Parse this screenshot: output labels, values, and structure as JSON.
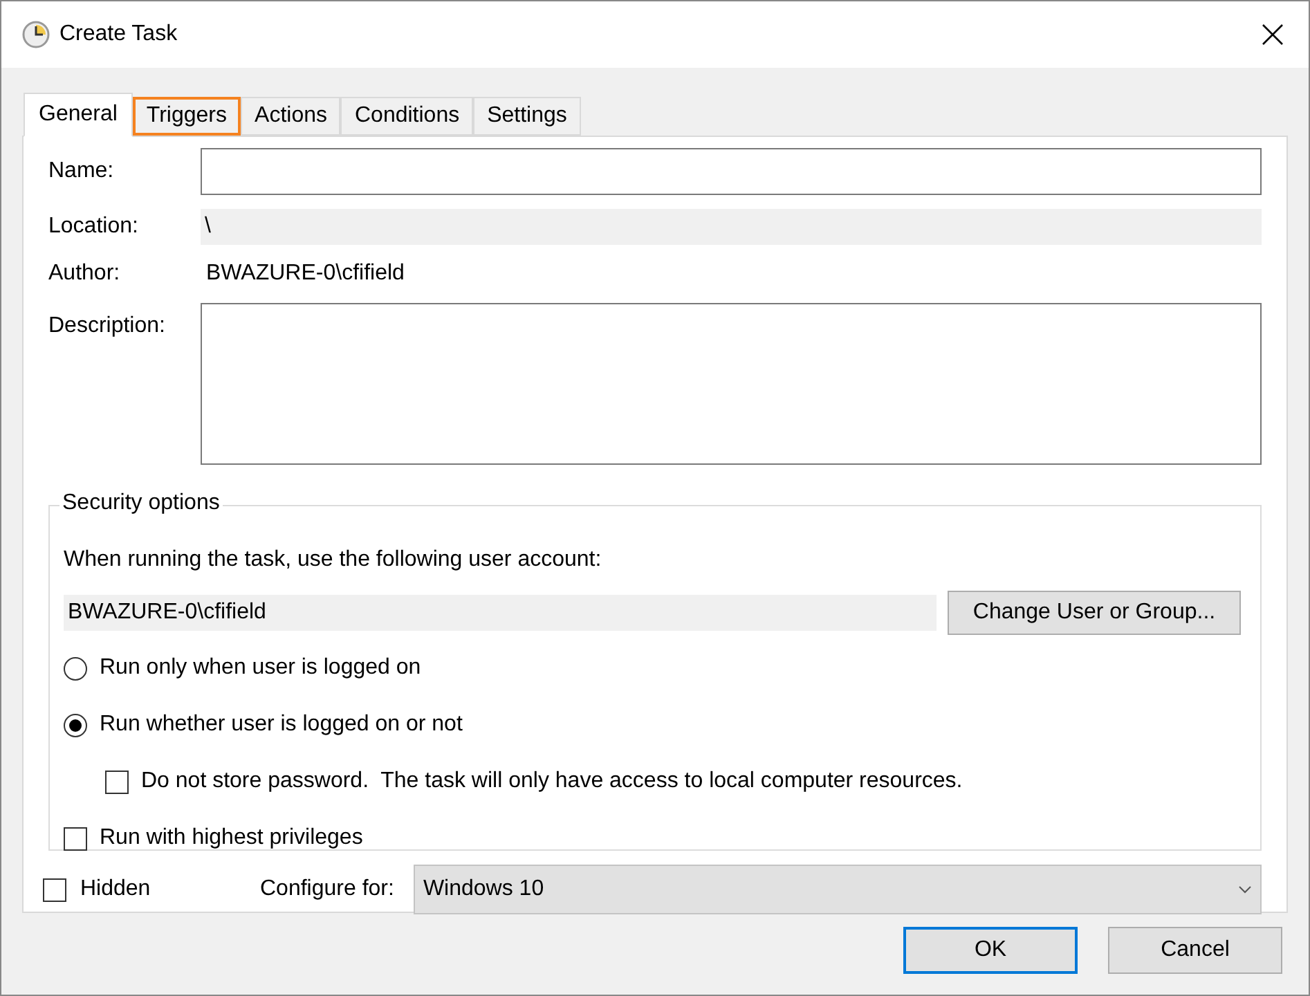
{
  "window": {
    "title": "Create Task"
  },
  "tabs": [
    {
      "label": "General",
      "selected": true,
      "highlighted": false
    },
    {
      "label": "Triggers",
      "selected": false,
      "highlighted": true
    },
    {
      "label": "Actions",
      "selected": false,
      "highlighted": false
    },
    {
      "label": "Conditions",
      "selected": false,
      "highlighted": false
    },
    {
      "label": "Settings",
      "selected": false,
      "highlighted": false
    }
  ],
  "general": {
    "name_label": "Name:",
    "location_label": "Location:",
    "location_value": "\\",
    "author_label": "Author:",
    "author_value": "BWAZURE-0\\cfifield",
    "description_label": "Description:"
  },
  "security": {
    "title": "Security options",
    "prompt": "When running the task, use the following user account:",
    "account": "BWAZURE-0\\cfifield",
    "change_button": "Change User or Group...",
    "options": [
      {
        "kind": "radio",
        "label": "Run only when user is logged on",
        "selected": false,
        "indented": false
      },
      {
        "kind": "radio",
        "label": "Run whether user is logged on or not",
        "selected": true,
        "indented": false
      },
      {
        "kind": "checkbox",
        "label": "Do not store password.  The task will only have access to local computer resources.",
        "checked": false,
        "indented": true
      },
      {
        "kind": "checkbox",
        "label": "Run with highest privileges",
        "checked": false,
        "indented": false
      }
    ]
  },
  "hidden": {
    "label": "Hidden",
    "checked": false
  },
  "configure": {
    "label": "Configure for:",
    "value": "Windows 10"
  },
  "buttons": [
    {
      "label": "OK",
      "default": true
    },
    {
      "label": "Cancel",
      "default": false
    }
  ]
}
